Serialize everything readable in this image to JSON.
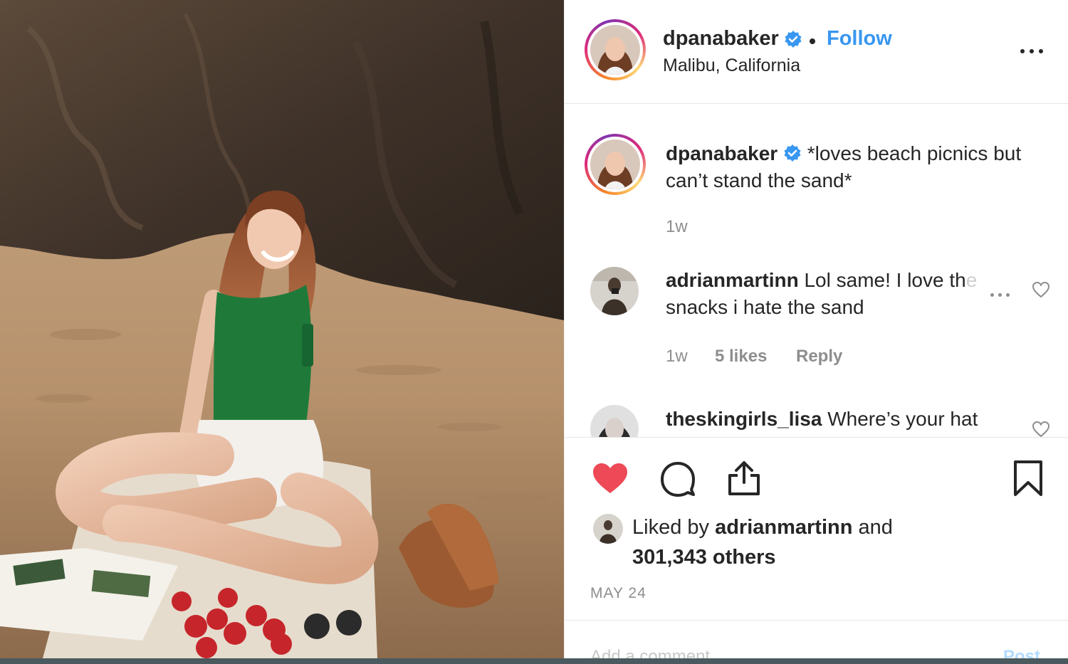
{
  "post": {
    "username": "dpanabaker",
    "follow_label": "Follow",
    "location": "Malibu, California",
    "caption": "*loves beach picnics but can’t stand the sand*",
    "caption_line1": "*loves beach picnics but",
    "caption_line2": "can’t stand the sand*",
    "caption_time": "1w",
    "liked_by_prefix": "Liked by",
    "liked_by_user": "adrianmartinn",
    "liked_by_and": "and",
    "likes_others": "301,343 others",
    "date": "MAY 24",
    "add_comment_placeholder": "Add a comment...",
    "post_button": "Post"
  },
  "comments": [
    {
      "username": "adrianmartinn",
      "text": "Lol same! I love the snacks i hate the sand",
      "line1": "Lol same! I love th",
      "line1_fade": "e",
      "line2": "snacks i hate the sand",
      "time": "1w",
      "likes": "5 likes",
      "reply_label": "Reply"
    },
    {
      "username": "theskingirls_lisa",
      "text": "Where’s your hat"
    }
  ],
  "icons": {
    "verified": "verified-badge-icon",
    "more": "more-horizontal-icon",
    "like": "heart-icon",
    "comment": "comment-bubble-icon",
    "share": "share-upload-icon",
    "save": "bookmark-icon"
  },
  "colors": {
    "accent": "#3897f0",
    "like_red": "#ed4956",
    "text": "#262626",
    "muted": "#8e8e8e"
  }
}
